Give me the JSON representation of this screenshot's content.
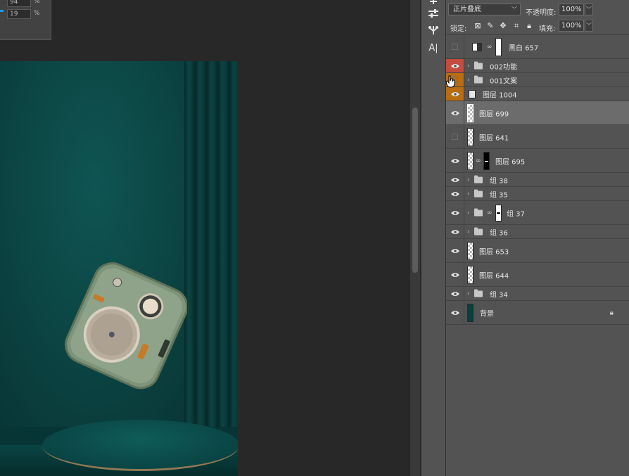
{
  "properties": {
    "field1_value": "94",
    "field2_value": "19",
    "unit": "%"
  },
  "layers_panel": {
    "blend_mode": "正片叠底",
    "opacity_label": "不透明度:",
    "opacity_value": "100%",
    "lock_label": "锁定:",
    "fill_label": "填充:",
    "fill_value": "100%",
    "layers": [
      {
        "name": "黑白 657",
        "type": "adjustment",
        "visible": false
      },
      {
        "name": "002功能",
        "type": "group",
        "visible": true,
        "tag_color": "#c24c3e"
      },
      {
        "name": "001文案",
        "type": "group",
        "visible": false,
        "tag_color": "#b86c13"
      },
      {
        "name": "图层 1004",
        "type": "smart",
        "visible": true,
        "tag_color": "#b86c13"
      },
      {
        "name": "图层 699",
        "type": "pixel",
        "visible": true,
        "selected": true
      },
      {
        "name": "图层 641",
        "type": "pixel",
        "visible": false
      },
      {
        "name": "图层 695",
        "type": "masked",
        "visible": true
      },
      {
        "name": "组 38",
        "type": "group",
        "visible": true
      },
      {
        "name": "组 35",
        "type": "group",
        "visible": true
      },
      {
        "name": "组 37",
        "type": "group-masked",
        "visible": true
      },
      {
        "name": "组 36",
        "type": "group",
        "visible": true
      },
      {
        "name": "图层 653",
        "type": "pixel",
        "visible": true
      },
      {
        "name": "图层 644",
        "type": "pixel",
        "visible": true
      },
      {
        "name": "组 34",
        "type": "group",
        "visible": true
      },
      {
        "name": "背景",
        "type": "background",
        "visible": true,
        "locked": true
      }
    ]
  },
  "toolstrip": {
    "text_tool_label": "A|"
  },
  "colors": {
    "panel_bg": "#535353",
    "selected_row": "#6c6c6c",
    "canvas_teal": "#0a3f3e",
    "red_tag": "#c24c3e",
    "orange_tag": "#b86c13"
  }
}
